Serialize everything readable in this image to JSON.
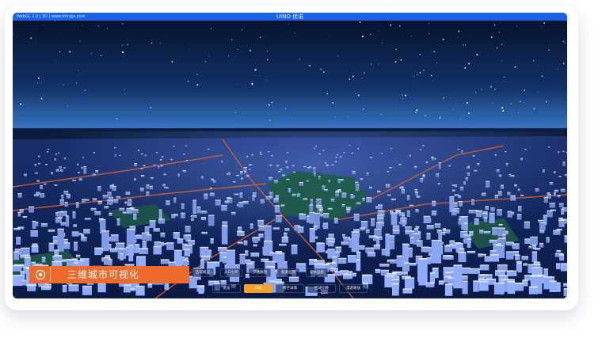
{
  "app": {
    "window_meta": "WebGL 2.0 | 3D | www.thingjs.com",
    "brand": "UINO 优诺"
  },
  "banner": {
    "title": "三维城市可视化",
    "icon": "badge-icon",
    "color": "#ee6a2b"
  },
  "toolbar": {
    "row1": [
      "区域概况",
      "人口分布",
      "交通路网",
      "能源监测",
      "安防监控"
    ],
    "row2": [
      "总览",
      "三维",
      "楼宇详情",
      "区域切换",
      "漫游路线"
    ],
    "active_index": 1,
    "accent_color": "#f2a12b"
  },
  "colors": {
    "titlebar": "#1a63e6",
    "sky_top": "#0a1a44",
    "sky_horizon": "#3a78c8"
  }
}
